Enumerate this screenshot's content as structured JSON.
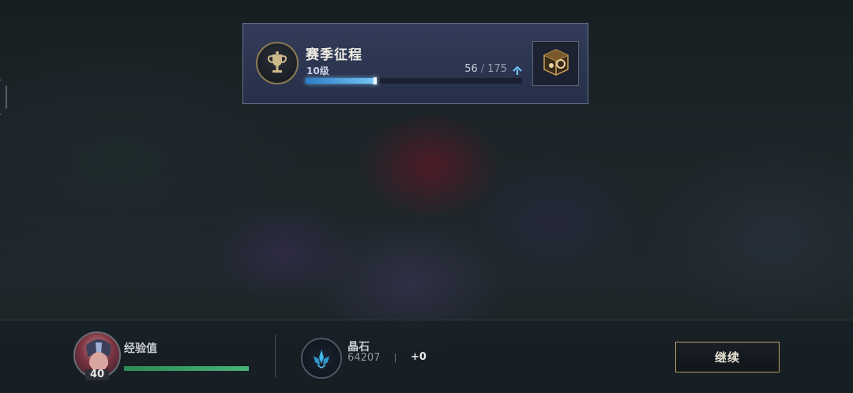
{
  "season_pass": {
    "title": "赛季征程",
    "level": "10级",
    "progress_current": "56",
    "progress_separator": "/",
    "progress_max": "175",
    "progress_fraction": 0.32,
    "bar_color": "#74c6f4"
  },
  "player": {
    "level": "40",
    "exp_label": "经验值",
    "exp_fraction": 1.0,
    "exp_color": "#47b27a"
  },
  "currency": {
    "label": "晶石",
    "value": "64207",
    "gain": "+0",
    "icon": "crystal-icon"
  },
  "actions": {
    "continue_label": "继续"
  },
  "icons": {
    "trophy": "trophy-icon",
    "level_up": "up-arrow-icon",
    "reward": "treasure-box-icon"
  }
}
